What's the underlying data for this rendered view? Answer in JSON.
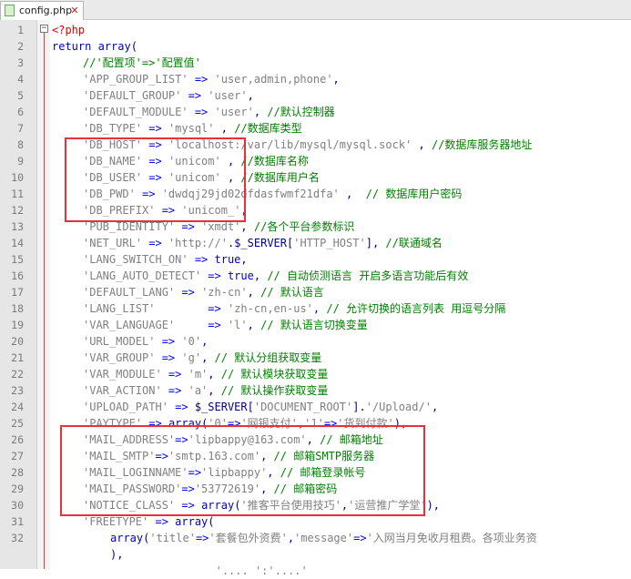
{
  "tab": {
    "filename": "config.php",
    "close_icon": "close-icon",
    "file_icon": "php-file-icon"
  },
  "editor": {
    "lines": [
      {
        "n": "1",
        "parts": [
          [
            "tag",
            "<?php"
          ]
        ]
      },
      {
        "n": "2",
        "parts": [
          [
            "kw",
            "return "
          ],
          [
            "fn",
            "array"
          ],
          [
            "pn",
            "("
          ]
        ]
      },
      {
        "n": "3",
        "parts": [
          [
            "cm",
            "//'配置项'=>'配置值'"
          ]
        ]
      },
      {
        "n": "4",
        "parts": [
          [
            "str",
            "'APP_GROUP_LIST'"
          ],
          [
            "op",
            " => "
          ],
          [
            "str",
            "'user,admin,phone'"
          ],
          [
            "pn",
            ","
          ]
        ]
      },
      {
        "n": "5",
        "parts": [
          [
            "str",
            "'DEFAULT_GROUP'"
          ],
          [
            "op",
            " => "
          ],
          [
            "str",
            "'user'"
          ],
          [
            "pn",
            ","
          ]
        ]
      },
      {
        "n": "6",
        "parts": [
          [
            "str",
            "'DEFAULT_MODULE'"
          ],
          [
            "op",
            " => "
          ],
          [
            "str",
            "'user'"
          ],
          [
            "pn",
            ", "
          ],
          [
            "cm",
            "//默认控制器"
          ]
        ]
      },
      {
        "n": "7",
        "parts": [
          [
            "str",
            "'DB_TYPE'"
          ],
          [
            "op",
            " => "
          ],
          [
            "str",
            "'mysql'"
          ],
          [
            "pn",
            " , "
          ],
          [
            "cm",
            "//数据库类型"
          ]
        ]
      },
      {
        "n": "8",
        "parts": [
          [
            "str",
            "'DB_HOST'"
          ],
          [
            "op",
            " => "
          ],
          [
            "str",
            "'localhost:/var/lib/mysql/mysql.sock'"
          ],
          [
            "pn",
            " , "
          ],
          [
            "cm",
            "//数据库服务器地址"
          ]
        ]
      },
      {
        "n": "9",
        "parts": [
          [
            "str",
            "'DB_NAME'"
          ],
          [
            "op",
            " => "
          ],
          [
            "str",
            "'unicom'"
          ],
          [
            "pn",
            " , "
          ],
          [
            "cm",
            "//数据库名称"
          ]
        ]
      },
      {
        "n": "10",
        "parts": [
          [
            "str",
            "'DB_USER'"
          ],
          [
            "op",
            " => "
          ],
          [
            "str",
            "'unicom'"
          ],
          [
            "pn",
            " , "
          ],
          [
            "cm",
            "//数据库用户名"
          ]
        ]
      },
      {
        "n": "11",
        "parts": [
          [
            "str",
            "'DB_PWD'"
          ],
          [
            "op",
            " => "
          ],
          [
            "str",
            "'dwdqj29jd02dfdasfwmf21dfa'"
          ],
          [
            "pn",
            " ,  "
          ],
          [
            "cm",
            "// 数据库用户密码"
          ]
        ]
      },
      {
        "n": "12",
        "parts": [
          [
            "str",
            "'DB_PREFIX'"
          ],
          [
            "op",
            " => "
          ],
          [
            "str",
            "'unicom_'"
          ],
          [
            "pn",
            ","
          ]
        ]
      },
      {
        "n": "13",
        "parts": [
          [
            "str",
            "'PUB_IDENTITY'"
          ],
          [
            "op",
            " => "
          ],
          [
            "str",
            "'xmdt'"
          ],
          [
            "pn",
            ", "
          ],
          [
            "cm",
            "//各个平台参数标识"
          ]
        ]
      },
      {
        "n": "14",
        "parts": [
          [
            "str",
            "'NET_URL'"
          ],
          [
            "op",
            " => "
          ],
          [
            "str",
            "'http://'"
          ],
          [
            "pn",
            "."
          ],
          [
            "var",
            "$_SERVER"
          ],
          [
            "pn",
            "["
          ],
          [
            "str",
            "'HTTP_HOST'"
          ],
          [
            "pn",
            "], "
          ],
          [
            "cm",
            "//联通域名"
          ]
        ]
      },
      {
        "n": "15",
        "parts": [
          [
            "str",
            "'LANG_SWITCH_ON'"
          ],
          [
            "op",
            " => "
          ],
          [
            "kw",
            "true"
          ],
          [
            "pn",
            ","
          ]
        ]
      },
      {
        "n": "16",
        "parts": [
          [
            "str",
            "'LANG_AUTO_DETECT'"
          ],
          [
            "op",
            " => "
          ],
          [
            "kw",
            "true"
          ],
          [
            "pn",
            ", "
          ],
          [
            "cm",
            "// 自动侦测语言 开启多语言功能后有效"
          ]
        ]
      },
      {
        "n": "17",
        "parts": [
          [
            "str",
            "'DEFAULT_LANG'"
          ],
          [
            "op",
            " => "
          ],
          [
            "str",
            "'zh-cn'"
          ],
          [
            "pn",
            ", "
          ],
          [
            "cm",
            "// 默认语言"
          ]
        ]
      },
      {
        "n": "18",
        "parts": [
          [
            "str",
            "'LANG_LIST'"
          ],
          [
            "op",
            "        => "
          ],
          [
            "str",
            "'zh-cn,en-us'"
          ],
          [
            "pn",
            ", "
          ],
          [
            "cm",
            "// 允许切换的语言列表 用逗号分隔"
          ]
        ]
      },
      {
        "n": "19",
        "parts": [
          [
            "str",
            "'VAR_LANGUAGE'"
          ],
          [
            "op",
            "     => "
          ],
          [
            "str",
            "'l'"
          ],
          [
            "pn",
            ", "
          ],
          [
            "cm",
            "// 默认语言切换变量"
          ]
        ]
      },
      {
        "n": "20",
        "parts": [
          [
            "str",
            "'URL_MODEL'"
          ],
          [
            "op",
            " => "
          ],
          [
            "str",
            "'0'"
          ],
          [
            "pn",
            ","
          ]
        ]
      },
      {
        "n": "21",
        "parts": [
          [
            "str",
            "'VAR_GROUP'"
          ],
          [
            "op",
            " => "
          ],
          [
            "str",
            "'g'"
          ],
          [
            "pn",
            ", "
          ],
          [
            "cm",
            "// 默认分组获取变量"
          ]
        ]
      },
      {
        "n": "22",
        "parts": [
          [
            "str",
            "'VAR_MODULE'"
          ],
          [
            "op",
            " => "
          ],
          [
            "str",
            "'m'"
          ],
          [
            "pn",
            ", "
          ],
          [
            "cm",
            "// 默认模块获取变量"
          ]
        ]
      },
      {
        "n": "23",
        "parts": [
          [
            "str",
            "'VAR_ACTION'"
          ],
          [
            "op",
            " => "
          ],
          [
            "str",
            "'a'"
          ],
          [
            "pn",
            ", "
          ],
          [
            "cm",
            "// 默认操作获取变量"
          ]
        ]
      },
      {
        "n": "24",
        "parts": [
          [
            "str",
            "'UPLOAD_PATH'"
          ],
          [
            "op",
            " => "
          ],
          [
            "var",
            "$_SERVER"
          ],
          [
            "pn",
            "["
          ],
          [
            "str",
            "'DOCUMENT_ROOT'"
          ],
          [
            "pn",
            "]."
          ],
          [
            "str",
            "'/Upload/'"
          ],
          [
            "pn",
            ","
          ]
        ]
      },
      {
        "n": "25",
        "parts": [
          [
            "str",
            "'PAYTYPE'"
          ],
          [
            "op",
            " => "
          ],
          [
            "fn",
            "array"
          ],
          [
            "pn",
            "("
          ],
          [
            "str",
            "'0'"
          ],
          [
            "op",
            "=>"
          ],
          [
            "str",
            "'网银支付'"
          ],
          [
            "pn",
            ","
          ],
          [
            "str",
            "'1'"
          ],
          [
            "op",
            "=>"
          ],
          [
            "str",
            "'货到付款'"
          ],
          [
            "pn",
            "),"
          ]
        ]
      },
      {
        "n": "26",
        "parts": [
          [
            "str",
            "'MAIL_ADDRESS'"
          ],
          [
            "op",
            "=>"
          ],
          [
            "str",
            "'lipbappy@163.com'"
          ],
          [
            "pn",
            ", "
          ],
          [
            "cm",
            "// 邮箱地址"
          ]
        ]
      },
      {
        "n": "27",
        "parts": [
          [
            "str",
            "'MAIL_SMTP'"
          ],
          [
            "op",
            "=>"
          ],
          [
            "str",
            "'smtp.163.com'"
          ],
          [
            "pn",
            ", "
          ],
          [
            "cm",
            "// 邮箱SMTP服务器"
          ]
        ]
      },
      {
        "n": "28",
        "parts": [
          [
            "str",
            "'MAIL_LOGINNAME'"
          ],
          [
            "op",
            "=>"
          ],
          [
            "str",
            "'lipbappy'"
          ],
          [
            "pn",
            ", "
          ],
          [
            "cm",
            "// 邮箱登录帐号"
          ]
        ]
      },
      {
        "n": "29",
        "parts": [
          [
            "str",
            "'MAIL_PASSWORD'"
          ],
          [
            "op",
            "=>"
          ],
          [
            "str",
            "'53772619'"
          ],
          [
            "pn",
            ", "
          ],
          [
            "cm",
            "// 邮箱密码"
          ]
        ]
      },
      {
        "n": "30",
        "parts": [
          [
            "str",
            "'NOTICE_CLASS'"
          ],
          [
            "op",
            " => "
          ],
          [
            "fn",
            "array"
          ],
          [
            "pn",
            "("
          ],
          [
            "str",
            "'推客平台使用技巧'"
          ],
          [
            "pn",
            ","
          ],
          [
            "str",
            "'运营推广学堂'"
          ],
          [
            "pn",
            "),"
          ]
        ]
      },
      {
        "n": "31",
        "parts": [
          [
            "str",
            "'FREETYPE'"
          ],
          [
            "op",
            " => "
          ],
          [
            "fn",
            "array"
          ],
          [
            "pn",
            "("
          ]
        ]
      },
      {
        "n": "32",
        "parts": [
          [
            "fn",
            "array"
          ],
          [
            "pn",
            "("
          ],
          [
            "str",
            "'title'"
          ],
          [
            "op",
            "=>"
          ],
          [
            "str",
            "'套餐包外资费'"
          ],
          [
            "pn",
            ","
          ],
          [
            "str",
            "'message'"
          ],
          [
            "op",
            "=>"
          ],
          [
            "str",
            "'入网当月免收月租费。各项业务资"
          ]
        ]
      },
      {
        "n": "",
        "parts": [
          [
            "pn",
            "),"
          ]
        ]
      },
      {
        "n": "",
        "parts": [
          [
            "str",
            "                '.... ':'....'"
          ]
        ]
      }
    ]
  },
  "colors": {
    "highlight_box": "#e8303a",
    "fold_line": "#d24040"
  }
}
